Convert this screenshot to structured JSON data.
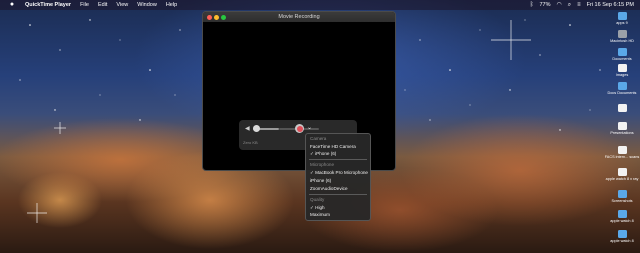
{
  "menubar": {
    "apple": "",
    "app_name": "QuickTime Player",
    "items": [
      "File",
      "Edit",
      "View",
      "Window",
      "Help"
    ],
    "battery": "77%",
    "datetime": "Fri 16 Sep 6:15 PM"
  },
  "window": {
    "title": "Movie Recording",
    "size_label": "Zero KB"
  },
  "menu": {
    "camera_header": "Camera",
    "camera_items": [
      "FaceTime HD Camera",
      "✓ iPhone (6)"
    ],
    "mic_header": "Microphone",
    "mic_items": [
      "✓ MacBook Pro Microphone",
      "iPhone (6)",
      "ZoomAudioDevice"
    ],
    "quality_header": "Quality",
    "quality_items": [
      "✓ High",
      "Maximum"
    ]
  },
  "desktop_icons": [
    "apps 9",
    "Macintosh HD",
    "Documents",
    "Images",
    "Docs Documents",
    "",
    "Presentations",
    "FACS intern... scans",
    "apple watch 8 x ray",
    "Screenshots",
    "apple watch 8",
    "apple watch 8"
  ],
  "colors": {
    "record": "#e0505a",
    "menu_bg": "#282828",
    "window_bg": "#000000"
  }
}
